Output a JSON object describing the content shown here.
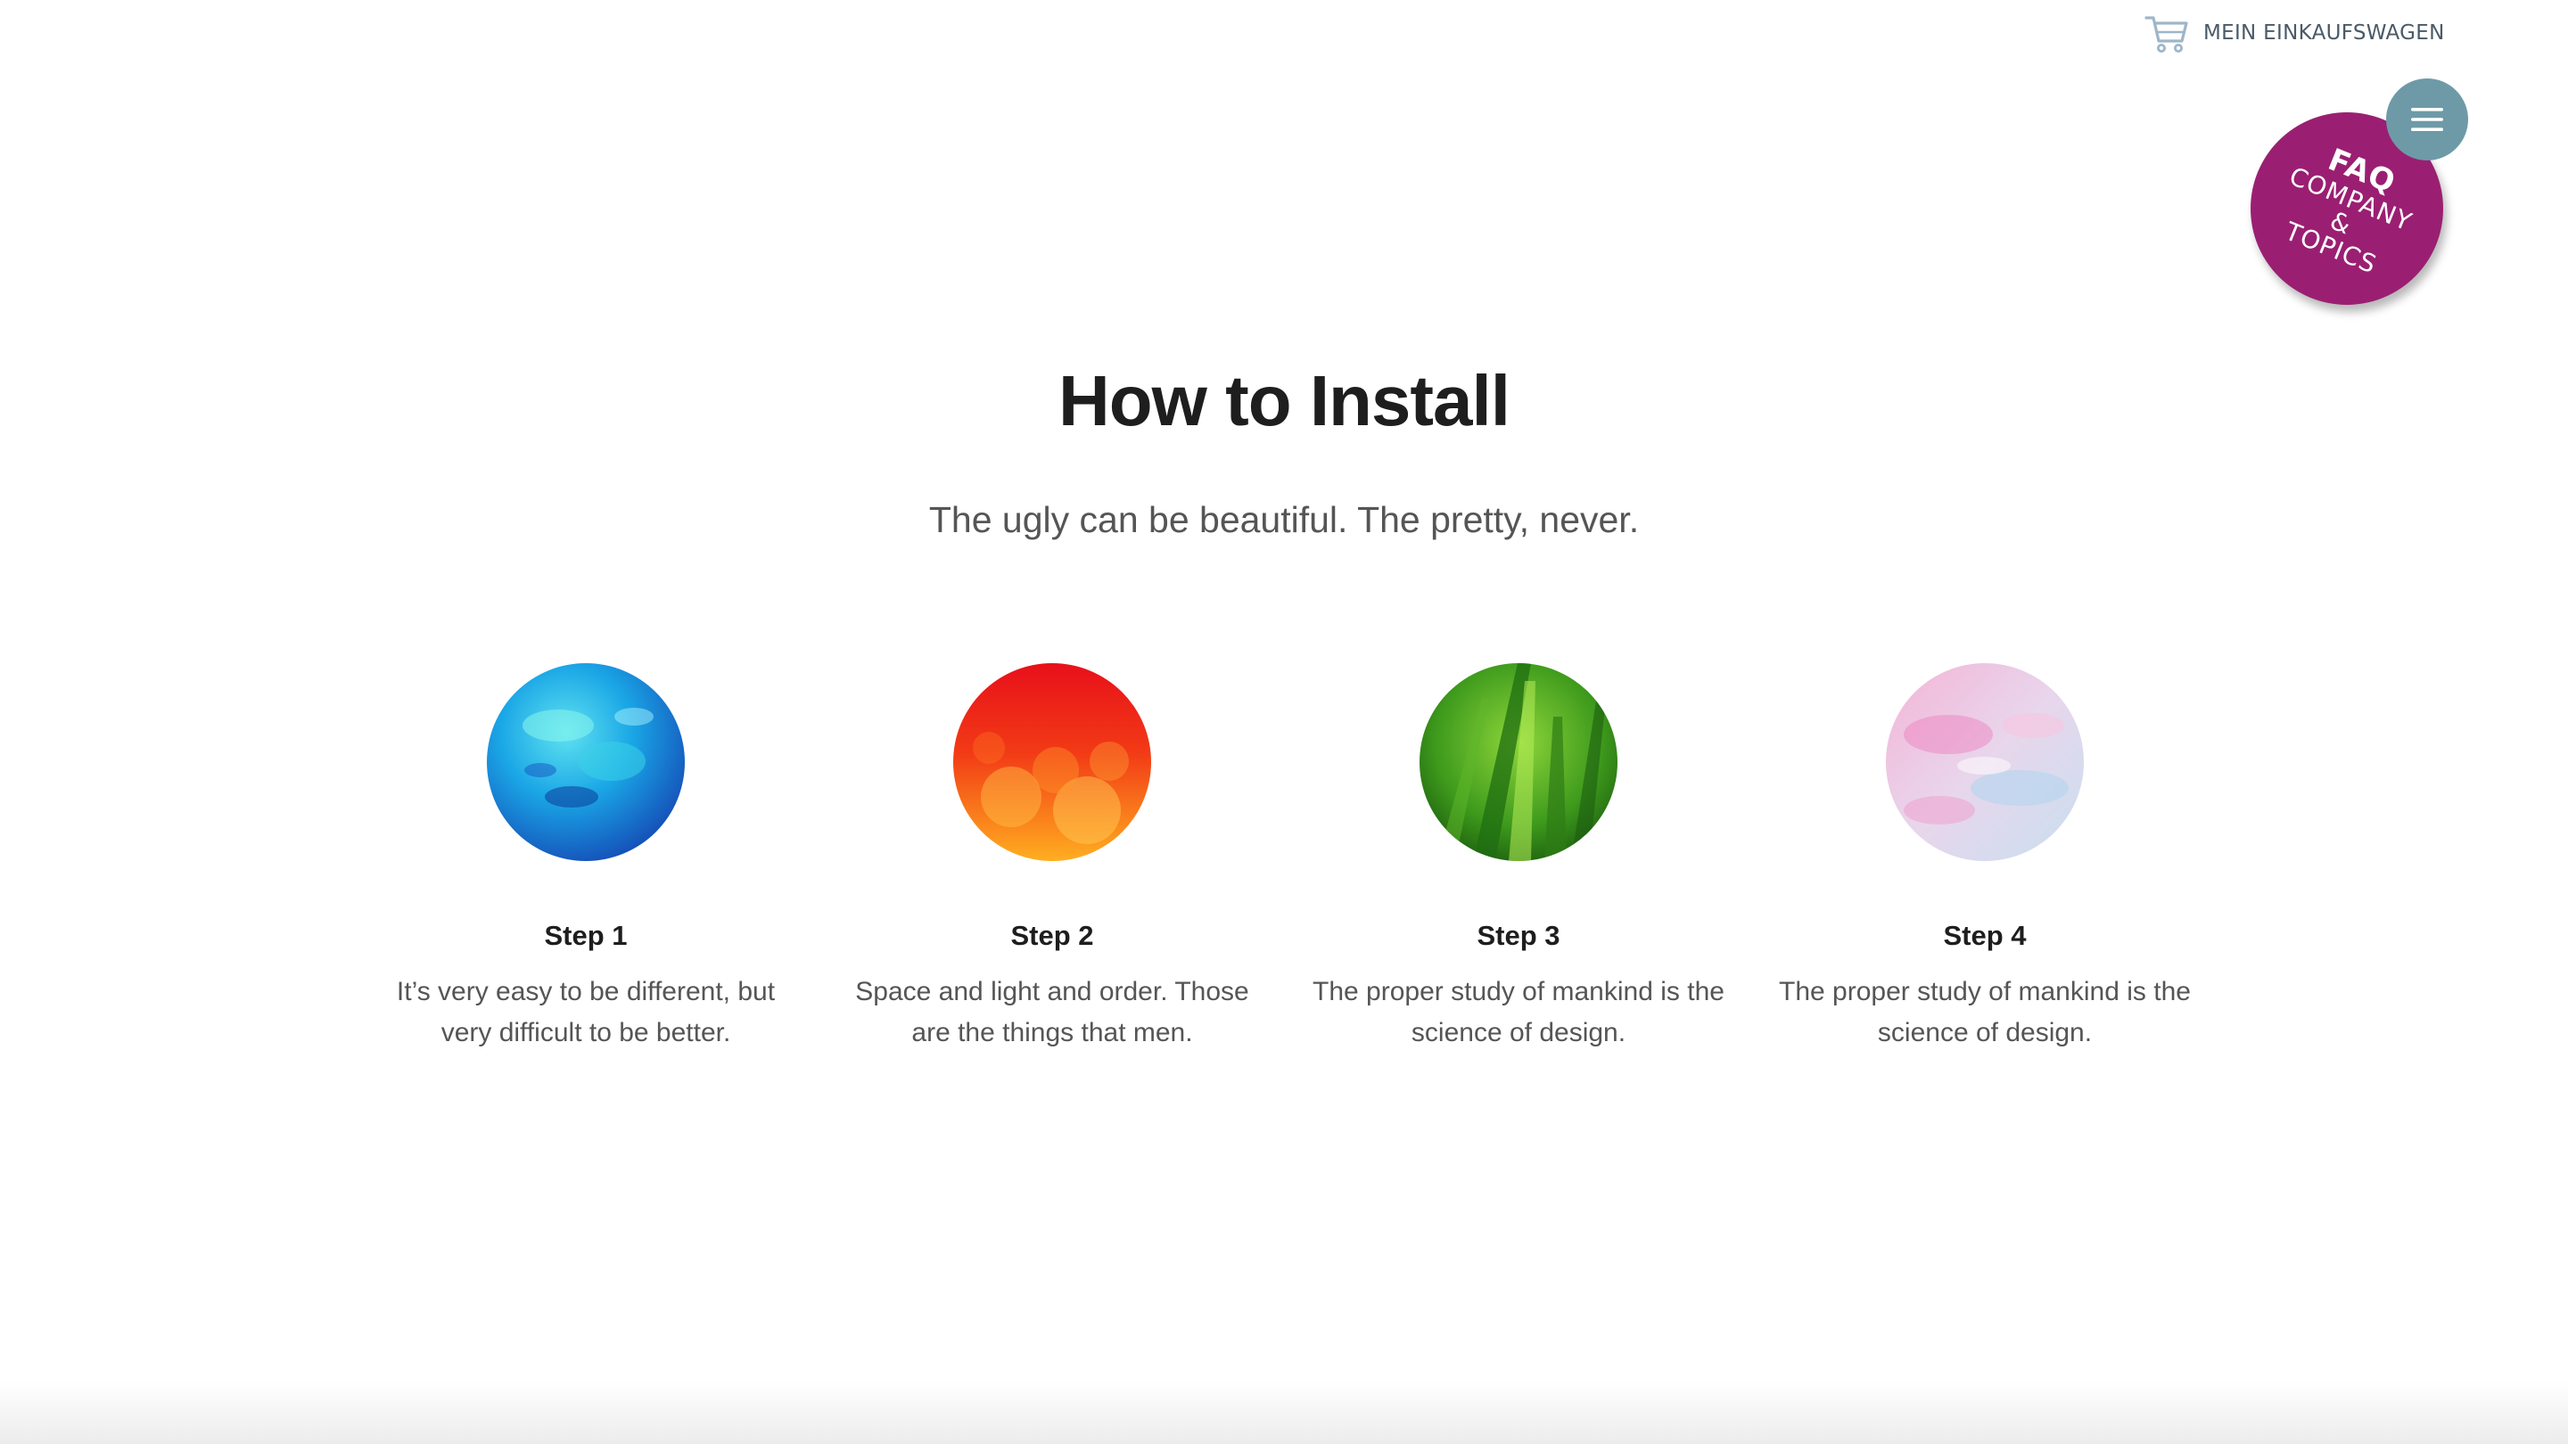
{
  "header": {
    "cart_icon": "shopping-cart-icon",
    "cart_label": "MEIN EINKAUFSWAGEN",
    "menu_icon": "hamburger-menu-icon"
  },
  "faq_badge": {
    "title": "FAQ",
    "line1": "COMPANY",
    "line2": "&",
    "line3": "TOPICS",
    "color": "#9a1f72"
  },
  "section": {
    "title": "How to Install",
    "subtitle": "The ugly can be beautiful. The pretty, never."
  },
  "steps": [
    {
      "title": "Step 1",
      "text": "It’s very easy to be different, but very difficult to be better.",
      "image": "blue-abstract-image"
    },
    {
      "title": "Step 2",
      "text": "Space and light and order. Those are the things that men.",
      "image": "red-orange-bokeh-image"
    },
    {
      "title": "Step 3",
      "text": "The proper study of mankind is the science of design.",
      "image": "green-grass-image"
    },
    {
      "title": "Step 4",
      "text": "The proper study of mankind is the science of design.",
      "image": "pink-marble-image"
    }
  ],
  "colors": {
    "menu_button": "#6e9aa7",
    "heading": "#1e1e1e",
    "body_text": "#555555"
  }
}
